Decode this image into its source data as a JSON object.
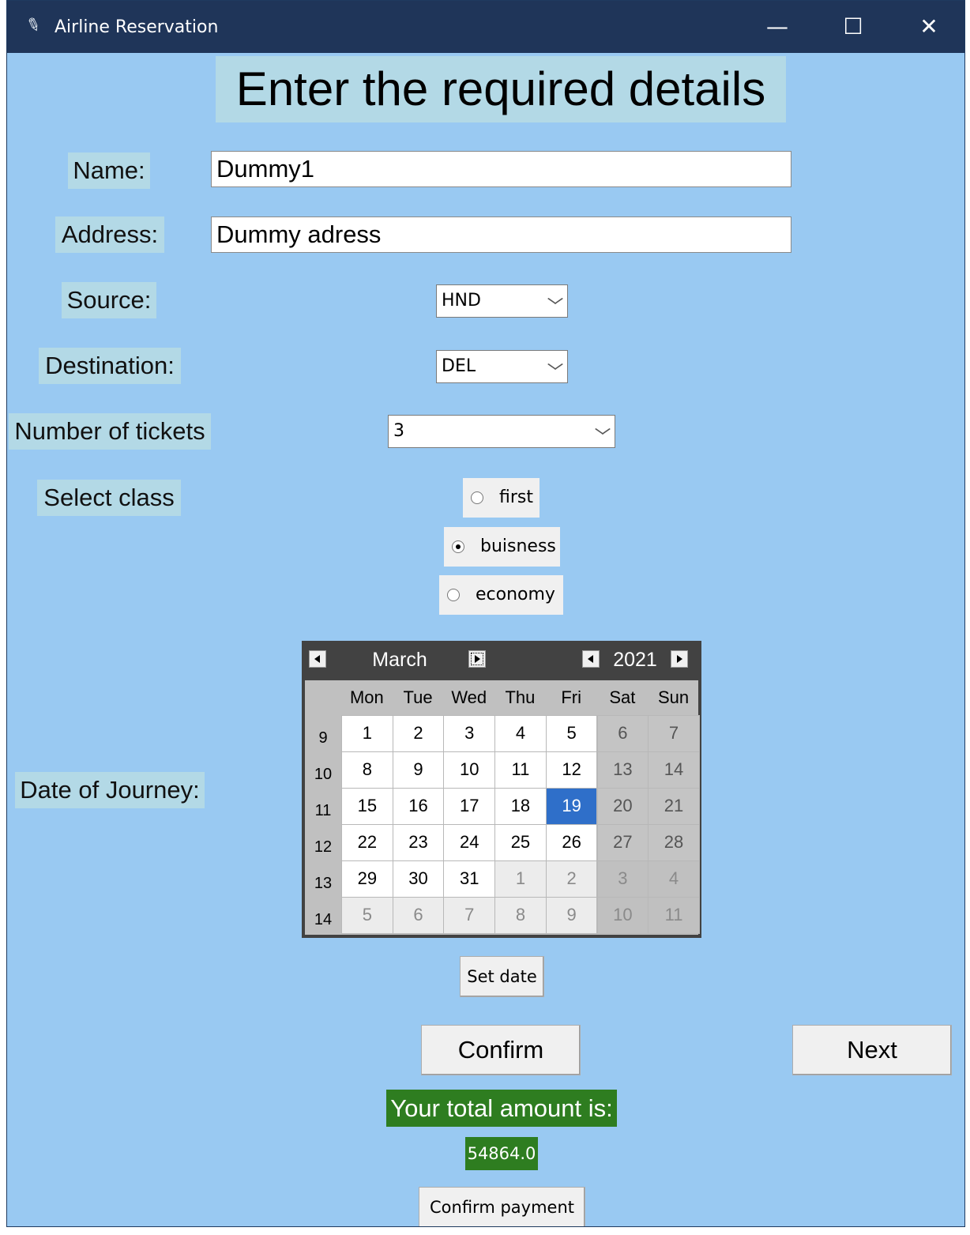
{
  "window": {
    "title": "Airline Reservation",
    "minimize": "—",
    "maximize": "☐",
    "close": "✕"
  },
  "heading": "Enter the required details",
  "form": {
    "name_label": "Name:",
    "name_value": "Dummy1",
    "address_label": "Address:",
    "address_value": "Dummy adress",
    "source_label": "Source:",
    "source_value": "HND",
    "destination_label": "Destination:",
    "destination_value": "DEL",
    "tickets_label": "Number of tickets",
    "tickets_value": "3",
    "class_label": "Select class",
    "class_options": [
      {
        "label": "first",
        "selected": false
      },
      {
        "label": "buisness",
        "selected": true
      },
      {
        "label": "economy",
        "selected": false
      }
    ],
    "date_label": "Date of Journey:"
  },
  "calendar": {
    "month": "March",
    "year": "2021",
    "weekdays": [
      "Mon",
      "Tue",
      "Wed",
      "Thu",
      "Fri",
      "Sat",
      "Sun"
    ],
    "weeks": [
      {
        "num": "9",
        "days": [
          "1",
          "2",
          "3",
          "4",
          "5",
          "6",
          "7"
        ]
      },
      {
        "num": "10",
        "days": [
          "8",
          "9",
          "10",
          "11",
          "12",
          "13",
          "14"
        ]
      },
      {
        "num": "11",
        "days": [
          "15",
          "16",
          "17",
          "18",
          "19",
          "20",
          "21"
        ]
      },
      {
        "num": "12",
        "days": [
          "22",
          "23",
          "24",
          "25",
          "26",
          "27",
          "28"
        ]
      },
      {
        "num": "13",
        "days": [
          "29",
          "30",
          "31",
          "1",
          "2",
          "3",
          "4"
        ]
      },
      {
        "num": "14",
        "days": [
          "5",
          "6",
          "7",
          "8",
          "9",
          "10",
          "11"
        ]
      }
    ],
    "selected_day": "19",
    "selected_color": "#2f6fc9"
  },
  "buttons": {
    "set_date": "Set date",
    "confirm": "Confirm",
    "next": "Next",
    "confirm_payment": "Confirm payment"
  },
  "total": {
    "label": "Your total amount is:",
    "value": "54864.0",
    "color": "#2e7d20"
  },
  "colors": {
    "background": "#99c9f2",
    "label_bg": "#b3d9e6",
    "titlebar": "#1f3559"
  }
}
